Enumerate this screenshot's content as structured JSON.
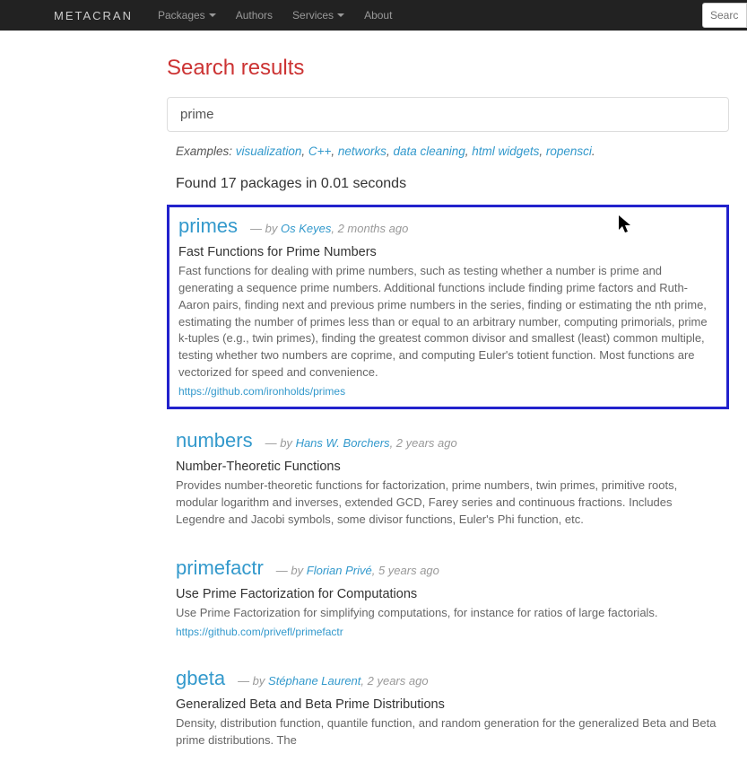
{
  "nav": {
    "brand": "METACRAN",
    "items": [
      "Packages",
      "Authors",
      "Services",
      "About"
    ],
    "search_placeholder": "Search for p"
  },
  "page": {
    "title": "Search results",
    "search_value": "prime",
    "examples_label": "Examples:",
    "examples": [
      "visualization",
      "C++",
      "networks",
      "data cleaning",
      "html widgets",
      "ropensci"
    ],
    "found_text": "Found 17 packages in 0.01 seconds"
  },
  "results": [
    {
      "name": "primes",
      "by": "— by ",
      "author": "Os Keyes",
      "time": ", 2 months ago",
      "title": "Fast Functions for Prime Numbers",
      "desc": "Fast functions for dealing with prime numbers, such as testing whether a number is prime and generating a sequence prime numbers. Additional functions include finding prime factors and Ruth-Aaron pairs, finding next and previous prime numbers in the series, finding or estimating the nth prime, estimating the number of primes less than or equal to an arbitrary number, computing primorials, prime k-tuples (e.g., twin primes), finding the greatest common divisor and smallest (least) common multiple, testing whether two numbers are coprime, and computing Euler's totient function. Most functions are vectorized for speed and convenience.",
      "url": "https://github.com/ironholds/primes",
      "highlighted": true
    },
    {
      "name": "numbers",
      "by": "— by ",
      "author": "Hans W. Borchers",
      "time": ", 2 years ago",
      "title": "Number-Theoretic Functions",
      "desc": "Provides number-theoretic functions for factorization, prime numbers, twin primes, primitive roots, modular logarithm and inverses, extended GCD, Farey series and continuous fractions. Includes Legendre and Jacobi symbols, some divisor functions, Euler's Phi function, etc.",
      "url": "",
      "highlighted": false
    },
    {
      "name": "primefactr",
      "by": "— by ",
      "author": "Florian Privé",
      "time": ", 5 years ago",
      "title": "Use Prime Factorization for Computations",
      "desc": "Use Prime Factorization for simplifying computations, for instance for ratios of large factorials.",
      "url": "https://github.com/privefl/primefactr",
      "highlighted": false
    },
    {
      "name": "gbeta",
      "by": "— by ",
      "author": "Stéphane Laurent",
      "time": ", 2 years ago",
      "title": "Generalized Beta and Beta Prime Distributions",
      "desc": "Density, distribution function, quantile function, and random generation for the generalized Beta and Beta prime distributions. The",
      "url": "",
      "highlighted": false
    }
  ]
}
